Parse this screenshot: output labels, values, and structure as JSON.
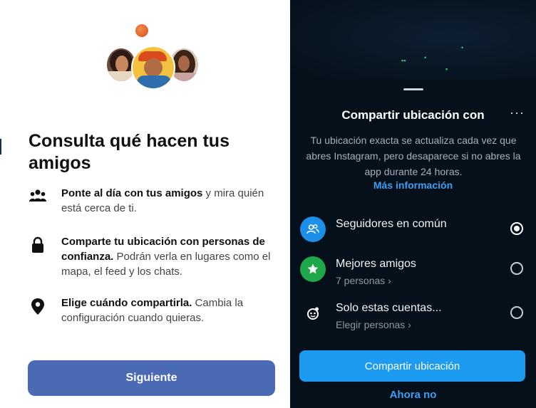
{
  "left": {
    "title": "Consulta qué hacen tus amigos",
    "features": [
      {
        "icon": "people-group-icon",
        "bold": "Ponte al día con tus amigos",
        "rest": " y mira quién está cerca de ti."
      },
      {
        "icon": "lock-icon",
        "bold": "Comparte tu ubicación con personas de confianza.",
        "rest": " Podrán verla en lugares como el mapa, el feed y los chats."
      },
      {
        "icon": "location-pin-icon",
        "bold": "Elige cuándo compartirla.",
        "rest": " Cambia la configuración cuando quieras."
      }
    ],
    "next_button": "Siguiente"
  },
  "right": {
    "title": "Compartir ubicación con",
    "more_label": "···",
    "description": "Tu ubicación exacta se actualiza cada vez que abres Instagram, pero desaparece si no abres la app durante 24 horas.",
    "learn_more": "Más información",
    "options": [
      {
        "label": "Seguidores en común",
        "sublabel": "",
        "icon": "mutual-followers-icon",
        "icon_color": "#1c8fe8",
        "selected": true
      },
      {
        "label": "Mejores amigos",
        "sublabel": "7 personas ›",
        "icon": "star-icon",
        "icon_color": "#1fa84a",
        "selected": false
      },
      {
        "label": "Solo estas cuentas...",
        "sublabel": "Elegir personas ›",
        "icon": "select-accounts-icon",
        "icon_color": "#06101a",
        "selected": false
      }
    ],
    "share_button": "Compartir ubicación",
    "not_now": "Ahora no"
  },
  "colors": {
    "next_button_bg": "#4a6ab4",
    "share_button_bg": "#1c9bf0",
    "link_blue": "#3b9ff5",
    "dark_bg": "#06101a"
  }
}
